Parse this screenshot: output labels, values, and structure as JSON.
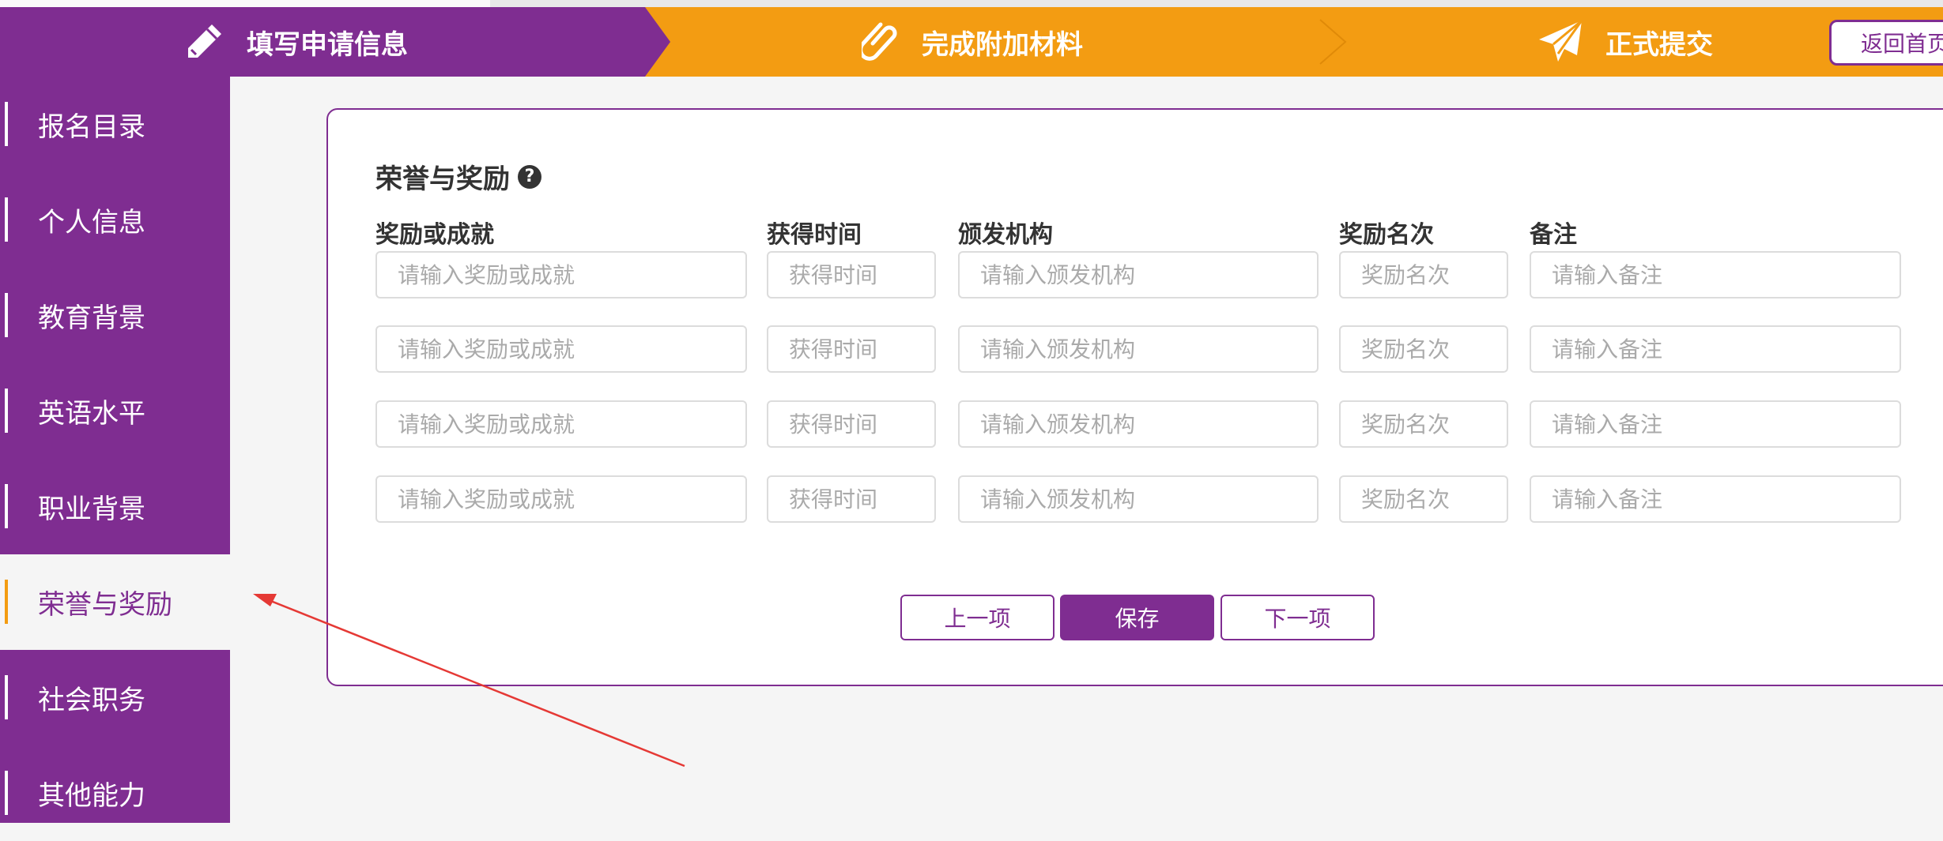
{
  "steps": [
    {
      "label": "填写申请信息",
      "icon": "pencil-icon"
    },
    {
      "label": "完成附加材料",
      "icon": "paperclip-icon"
    },
    {
      "label": "正式提交",
      "icon": "paper-plane-icon"
    }
  ],
  "header": {
    "home_label": "返回首页"
  },
  "sidebar": {
    "items": [
      {
        "label": "报名目录"
      },
      {
        "label": "个人信息"
      },
      {
        "label": "教育背景"
      },
      {
        "label": "英语水平"
      },
      {
        "label": "职业背景"
      },
      {
        "label": "荣誉与奖励"
      },
      {
        "label": "社会职务"
      },
      {
        "label": "其他能力"
      }
    ],
    "active_index": 5
  },
  "form": {
    "title": "荣誉与奖励",
    "help_icon": "question-circle-icon",
    "columns": [
      "奖励或成就",
      "获得时间",
      "颁发机构",
      "奖励名次",
      "备注"
    ],
    "placeholders": {
      "award": "请输入奖励或成就",
      "time": "获得时间",
      "org": "请输入颁发机构",
      "rank": "奖励名次",
      "note": "请输入备注"
    },
    "row_count": 4,
    "buttons": {
      "prev": "上一项",
      "save": "保存",
      "next": "下一项"
    }
  },
  "colors": {
    "purple": "#7f2d91",
    "orange": "#f39c12",
    "annotation_arrow": "#e53935"
  }
}
